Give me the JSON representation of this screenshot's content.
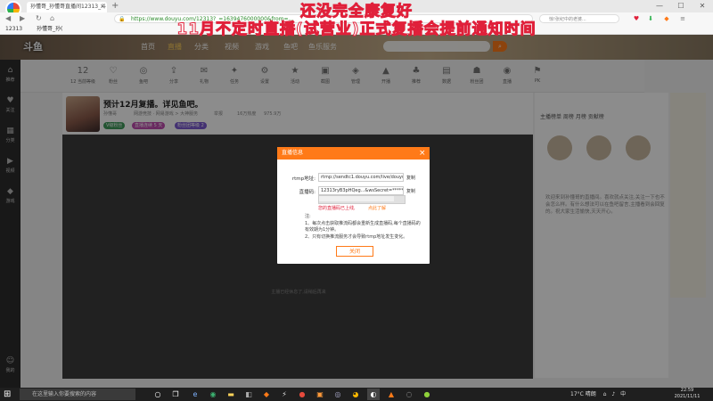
{
  "browser": {
    "tab_title": "孙懂哥_孙懂哥直播间12313_斗",
    "url": "https://www.douyu.com/12313?_=1639476000000&from=...",
    "search_placeholder": "惊!张纪中的老婆..."
  },
  "bookmarks": {
    "item": "12313",
    "item2": "孙懂哥_孙("
  },
  "overlay": {
    "line1": "还没完全康复好",
    "line2": "11月不定时直播(试营业)正式复播会提前通知时间"
  },
  "douyu": {
    "logo": "斗鱼",
    "nav": [
      "首页",
      "直播",
      "分类",
      "视频",
      "游戏",
      "鱼吧",
      "鱼乐服务"
    ]
  },
  "sidebar": {
    "items": [
      {
        "icon": "home-icon",
        "glyph": "⌂",
        "label": "推荐"
      },
      {
        "icon": "follow-icon",
        "glyph": "♥",
        "label": "关注"
      },
      {
        "icon": "category-icon",
        "glyph": "▦",
        "label": "分类"
      },
      {
        "icon": "video-icon",
        "glyph": "▶",
        "label": "视频"
      },
      {
        "icon": "game-icon",
        "glyph": "◆",
        "label": "游戏"
      },
      {
        "icon": "user-icon",
        "glyph": "☺",
        "label": "我的"
      }
    ]
  },
  "categories": [
    {
      "label": "12 当前等级",
      "glyph": "12"
    },
    {
      "label": "粉丝",
      "glyph": "♡"
    },
    {
      "label": "鱼吧",
      "glyph": "◎"
    },
    {
      "label": "分享",
      "glyph": "⇪"
    },
    {
      "label": "礼物",
      "glyph": "✉"
    },
    {
      "label": "任务",
      "glyph": "✦"
    },
    {
      "label": "设置",
      "glyph": "⚙"
    },
    {
      "label": "活动",
      "glyph": "★"
    },
    {
      "label": "截图",
      "glyph": "▣"
    },
    {
      "label": "管理",
      "glyph": "◈"
    },
    {
      "label": "开播",
      "glyph": "▲"
    },
    {
      "label": "推荐",
      "glyph": "♣"
    },
    {
      "label": "数据",
      "glyph": "▤"
    },
    {
      "label": "粉丝团",
      "glyph": "☗"
    },
    {
      "label": "直播",
      "glyph": "◉"
    },
    {
      "label": "PK",
      "glyph": "⚑"
    }
  ],
  "room": {
    "title": "预计12月复播。详见鱼吧。",
    "meta1": "孙懂哥",
    "meta2": "网游竞技 · 网易游戏 > 大神服务",
    "meta3": "举报",
    "meta4": "16万热度",
    "meta5": "975.9万",
    "pills": [
      "V级粉丝",
      "直播连续 5 天",
      "粉丝团等级 2"
    ],
    "hint": "主播已经休息了,请稍后再来"
  },
  "right_panel": {
    "tabs": "主播榜单  周榜  月榜  贡献榜",
    "notice": "欢迎来到孙懂哥的直播间。喜欢就点关注,关注一下也不会怎么样。有什么想法可以在鱼吧留言,主播看到会回复的。祝大家生活愉快,天天开心。"
  },
  "dialog": {
    "title": "直播信息",
    "rtmp_label": "rtmp地址:",
    "rtmp_value": "rtmp://sendtc1.douyu.com/live/douyu...",
    "key_label": "直播码:",
    "key_value": "12313ryB3pHQeg...&wsSecret=*******",
    "copy": "复制",
    "warning": "您的直播码已上线,",
    "warning_link": "点此了解",
    "note_title": "注:",
    "note1": "1、每次点击获取推流码都会重新生成直播码,每个直播码的有效期为1分钟。",
    "note2": "2、只有切换推流服务才会导致rtmp地址发生变化。",
    "close_button": "关闭"
  },
  "taskbar": {
    "search_placeholder": "在这里输入你要搜索的内容",
    "weather": "17°C 晴朗",
    "ime": "中",
    "time": "22:59",
    "date": "2021/11/11"
  },
  "colors": {
    "accent": "#ff7a18",
    "overlay_red": "#e0203a"
  }
}
